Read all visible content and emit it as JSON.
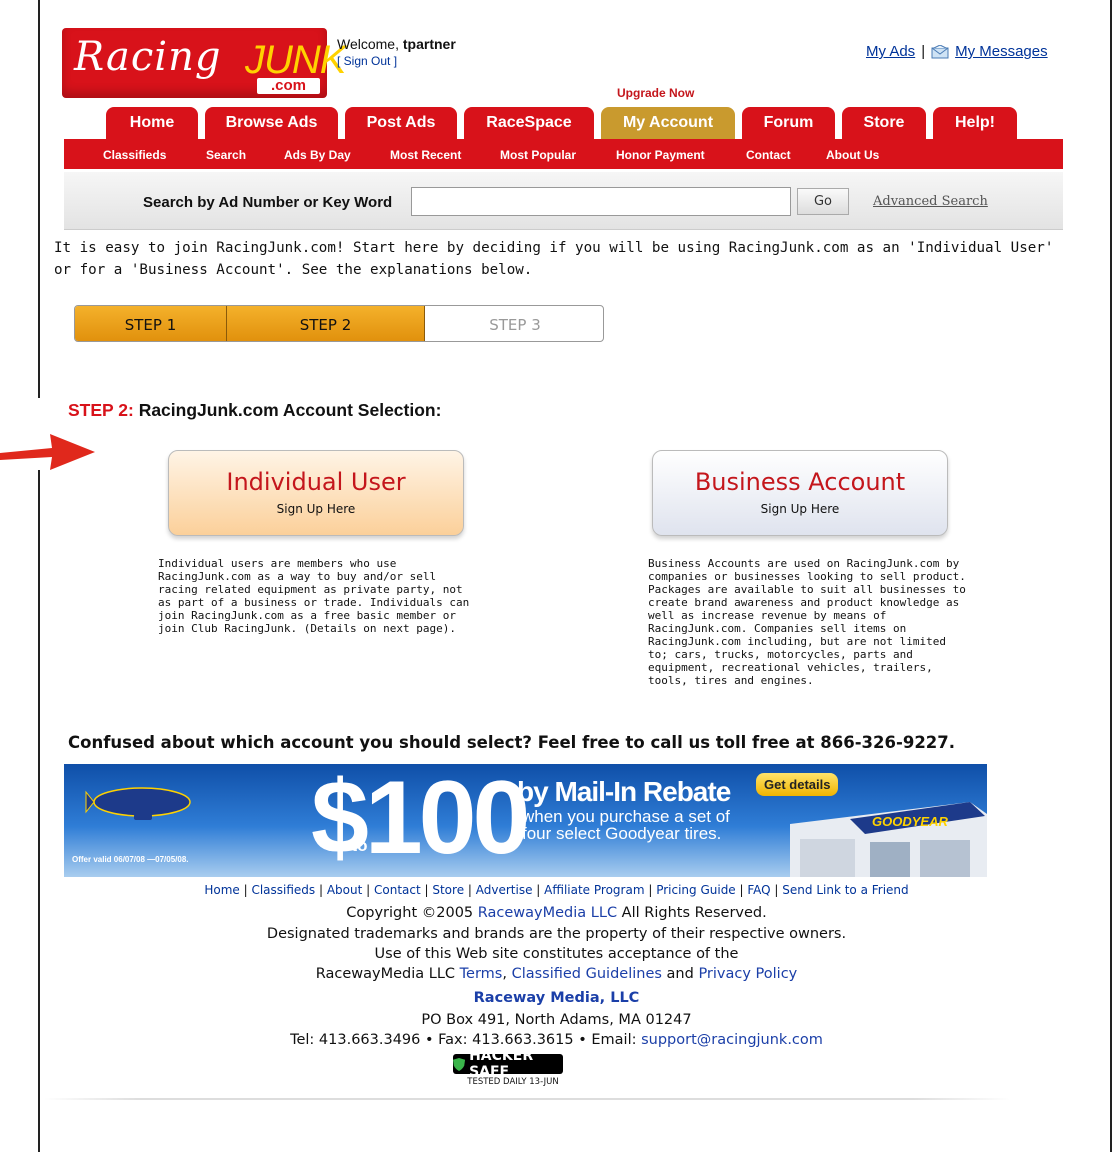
{
  "header": {
    "logo_racing": "Racing",
    "logo_junk": "JUNK",
    "logo_dotcom": ".com",
    "welcome_prefix": "Welcome, ",
    "username": "tpartner",
    "sign_out": "[ Sign Out ]",
    "my_ads": "My Ads",
    "separator": "|",
    "my_messages": "My Messages",
    "upgrade_now": "Upgrade Now"
  },
  "tabs": [
    "Home",
    "Browse Ads",
    "Post Ads",
    "RaceSpace",
    "My Account",
    "Forum",
    "Store",
    "Help!"
  ],
  "active_tab": "My Account",
  "subnav": [
    "Classifieds",
    "Search",
    "Ads By Day",
    "Most Recent",
    "Most Popular",
    "Honor Payment",
    "Contact",
    "About Us"
  ],
  "search": {
    "label": "Search by Ad Number or Key Word",
    "value": "",
    "go": "Go",
    "advanced": "Advanced Search"
  },
  "intro": "It is easy to join RacingJunk.com! Start here by deciding if you will be using RacingJunk.com as an 'Individual User' or for a 'Business Account'. See the explanations below.",
  "steps": [
    "STEP 1",
    "STEP 2",
    "STEP 3"
  ],
  "current_step": 2,
  "heading": {
    "prefix": "STEP 2:",
    "text": " RacingJunk.com Account Selection:"
  },
  "individual": {
    "title": "Individual User",
    "subtitle": "Sign Up Here",
    "description": "Individual users are members who use RacingJunk.com as a way to buy and/or sell racing related equipment as private party, not as part of a business or trade. Individuals can join RacingJunk.com as a free basic member or join Club RacingJunk. (Details on next page)."
  },
  "business": {
    "title": "Business Account",
    "subtitle": "Sign Up Here",
    "description": "Business Accounts are used on RacingJunk.com by companies or businesses looking to sell product. Packages are available to suit all businesses to create brand awareness and product knowledge as well as increase revenue by means of RacingJunk.com. Companies sell items on RacingJunk.com including, but are not limited to; cars, trucks, motorcycles, parts and equipment, recreational vehicles, trailers, tools, tires and engines."
  },
  "confused": "Confused about which account you should select? Feel free to call us toll free at 866-326-9227.",
  "banner": {
    "amount": "$100",
    "up_to": "up to",
    "headline": "by Mail-In Rebate",
    "sub1": "when you purchase a set of",
    "sub2": "four select Goodyear tires.",
    "get_details": "Get details",
    "offer": "Offer valid 06/07/08 —07/05/08.",
    "brand": "GOODYEAR"
  },
  "footer": {
    "links": [
      "Home",
      "Classifieds",
      "About",
      "Contact",
      "Store",
      "Advertise",
      "Affiliate Program",
      "Pricing Guide",
      "FAQ",
      "Send Link to a Friend"
    ],
    "copyright_pre": "Copyright ©2005 ",
    "copyright_company": "RacewayMedia LLC",
    "copyright_post": " All Rights Reserved.",
    "trademarks": "Designated trademarks and brands are the property of their respective owners.",
    "use_line": "Use of this Web site constitutes acceptance of the",
    "terms_pre": "RacewayMedia LLC ",
    "terms": "Terms",
    "comma": ", ",
    "guidelines": "Classified Guidelines",
    "and": " and ",
    "privacy": "Privacy Policy",
    "company": "Raceway Media, LLC",
    "address": "PO Box 491, North Adams, MA 01247",
    "contact_pre": "Tel: 413.663.3496 • Fax: 413.663.3615 • Email: ",
    "email": "support@racingjunk.com",
    "hacker_safe": "HACKER SAFE",
    "tested": "TESTED DAILY   13-JUN"
  },
  "colors": {
    "brand_red": "#d8121a",
    "active_tab": "#c99a2e",
    "link_blue": "#003399",
    "step_orange": "#f4b12b"
  }
}
